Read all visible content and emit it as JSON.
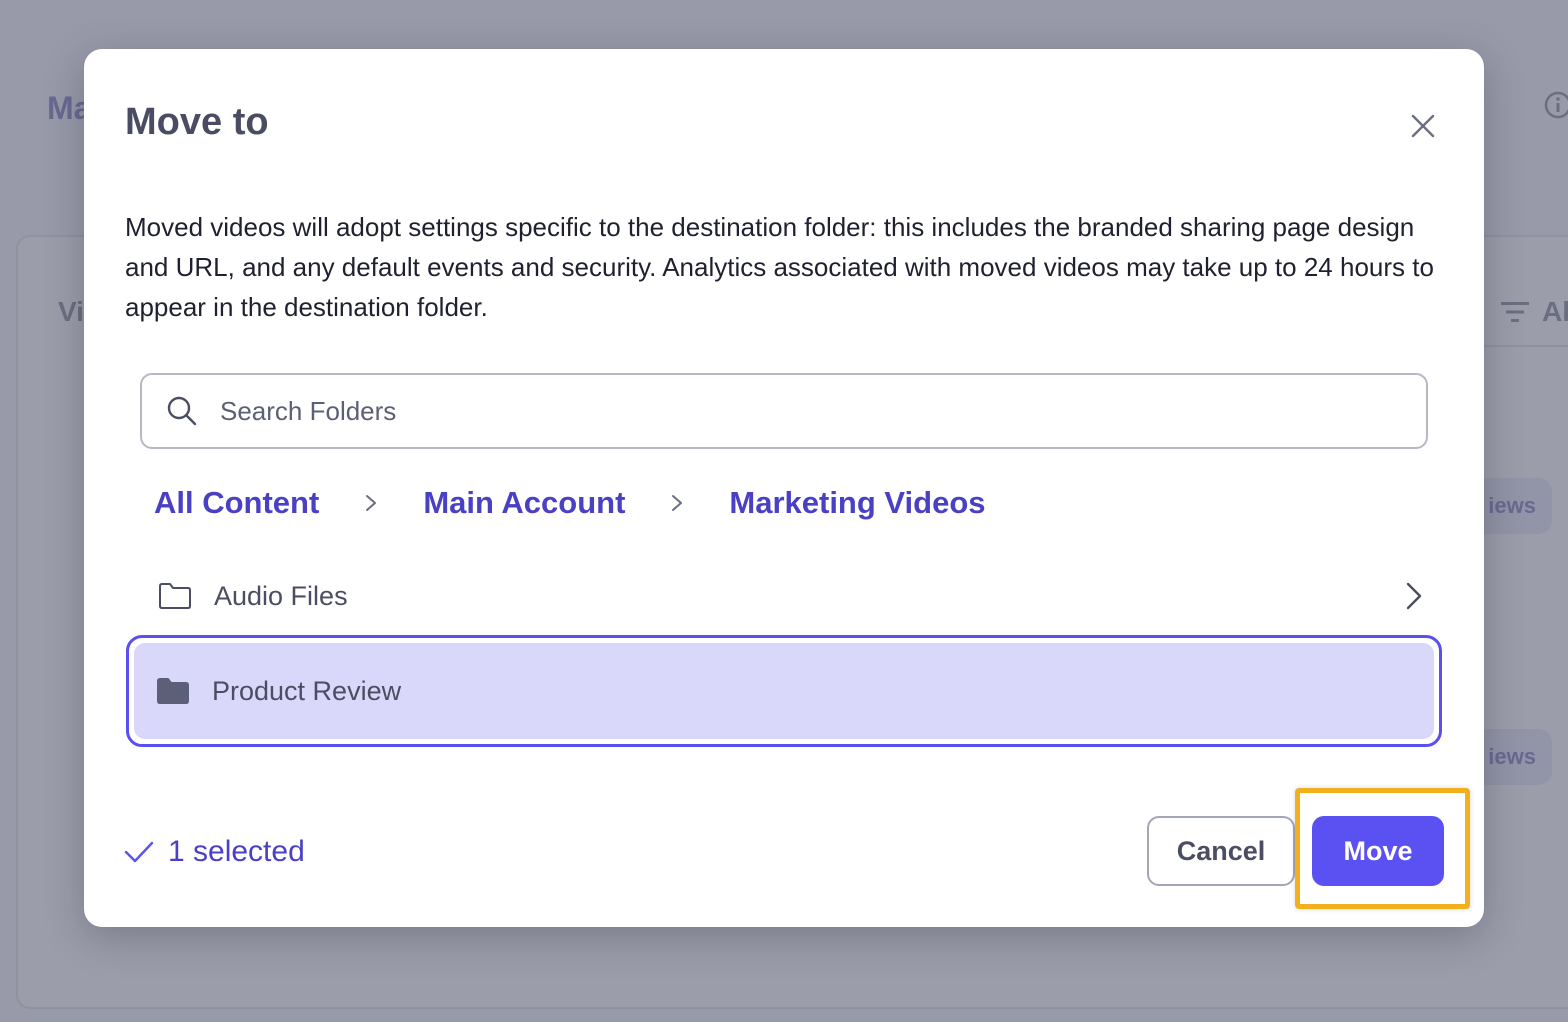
{
  "background": {
    "page_title": "Ma",
    "section_label": "Vi",
    "filter_label": "Al",
    "chip_label_1": "iews",
    "chip_label_2": "iews"
  },
  "modal": {
    "title": "Move to",
    "description": "Moved videos will adopt settings specific to the destination folder: this includes the branded sharing page design and URL, and any default events and security. Analytics associated with moved videos may take up to 24 hours to appear in the destination folder.",
    "search": {
      "placeholder": "Search Folders",
      "value": ""
    },
    "breadcrumb": [
      "All Content",
      "Main Account",
      "Marketing Videos"
    ],
    "folders": [
      {
        "name": "Audio Files",
        "has_children": true,
        "selected": false
      },
      {
        "name": "Product Review",
        "has_children": false,
        "selected": true
      }
    ],
    "selected_count": "1 selected",
    "cancel_label": "Cancel",
    "move_label": "Move"
  },
  "colors": {
    "accent": "#5b51f2",
    "link": "#4a40c4",
    "selected_bg": "#d9d8fb",
    "highlight": "#f2b01e"
  }
}
